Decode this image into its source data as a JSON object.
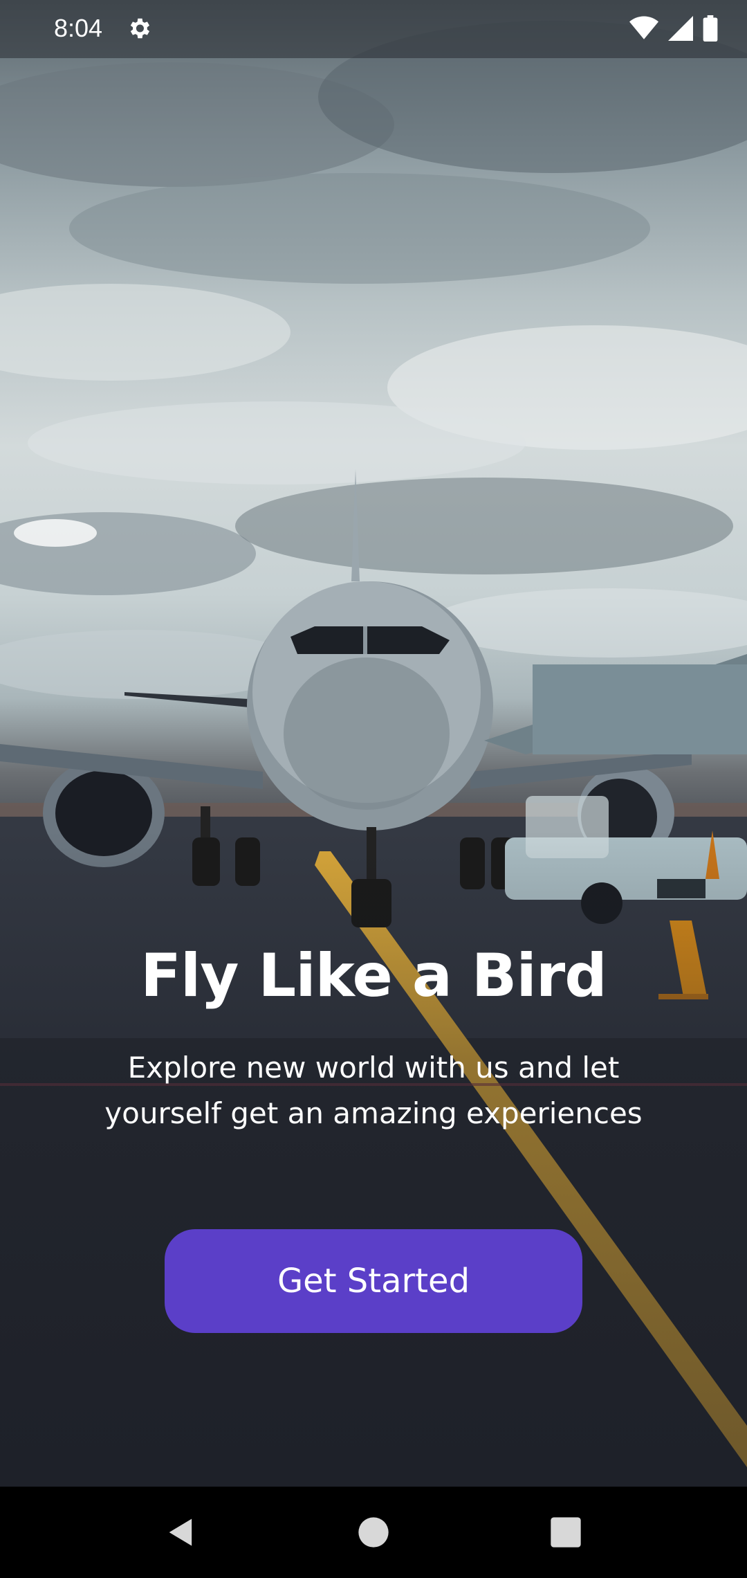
{
  "status_bar": {
    "time": "8:04",
    "icons": [
      "gear-icon",
      "wifi-icon",
      "signal-icon",
      "battery-icon"
    ]
  },
  "onboarding": {
    "title": "Fly Like a Bird",
    "subtitle_line1": "Explore new world with us and let",
    "subtitle_line2": "yourself get an amazing experiences",
    "cta_label": "Get Started"
  },
  "nav_bar": {
    "buttons": [
      "back-icon",
      "home-icon",
      "recents-icon"
    ]
  },
  "colors": {
    "accent": "#5b3fc8",
    "text": "#ffffff",
    "runway_line": "#e0b040"
  }
}
